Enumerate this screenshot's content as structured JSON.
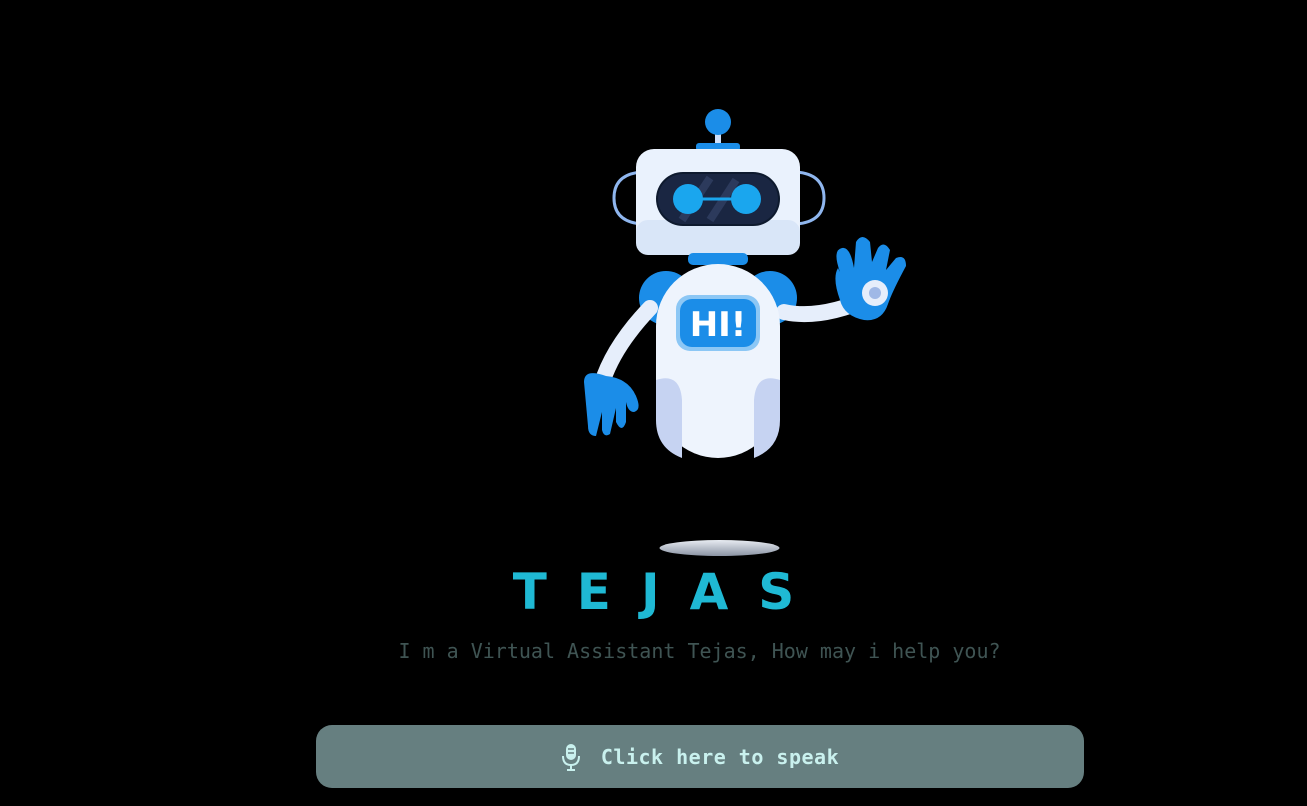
{
  "assistant": {
    "name": "TEJAS",
    "tagline": "I m a Virtual Assistant Tejas, How may i help you?",
    "robot_badge": "HI!"
  },
  "action": {
    "speak_label": "Click here to speak",
    "icon": "microphone-icon"
  },
  "colors": {
    "background": "#000000",
    "name": "#1fb9d4",
    "tagline": "#3f5453",
    "button_bg": "#667f80",
    "button_text": "#c9f1ee"
  }
}
